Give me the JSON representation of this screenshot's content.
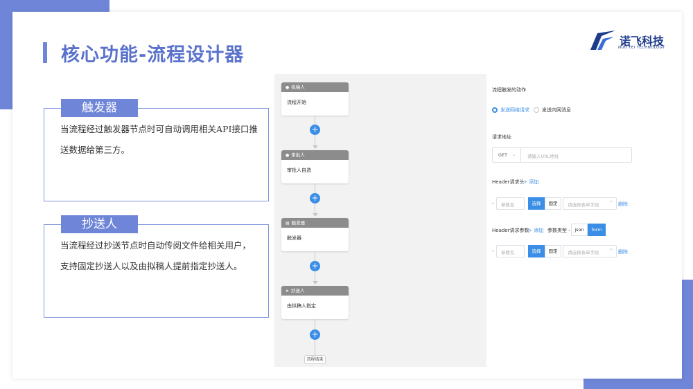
{
  "title": "核心功能-流程设计器",
  "logo": {
    "cn": "诺飞科技",
    "en": "NUO FEI TECHNOLOGY"
  },
  "features": [
    {
      "tag": "触发器",
      "lines": [
        "当流程经过触发器节点时可自动调用相关API接口推",
        "送数据给第三方。"
      ]
    },
    {
      "tag": "抄送人",
      "lines": [
        "当流程经过抄送节点时自动传阅文件给相关用户，",
        "支持固定抄送人以及由拟稿人提前指定抄送人。"
      ]
    }
  ],
  "flow": {
    "nodes": [
      {
        "head": "拟稿人",
        "body": "流程开始",
        "icon": "user-icon"
      },
      {
        "head": "审批人",
        "body": "审批人自选",
        "icon": "user-icon"
      },
      {
        "head": "触发器",
        "body": "触发器",
        "icon": "trigger-icon"
      },
      {
        "head": "抄送人",
        "body": "由拟稿人指定",
        "icon": "send-icon"
      }
    ],
    "plus_label": "+",
    "end_label": "流程结束"
  },
  "config": {
    "action_label": "流程触发的动作",
    "radio_options": [
      {
        "label": "发送网络请求",
        "selected": true
      },
      {
        "label": "发送内网消息",
        "selected": false
      }
    ],
    "url_label": "请求地址",
    "method": "GET",
    "url_placeholder": "请输入URL地址",
    "header_label": "Header请求头",
    "add_label": "+ 添加",
    "header_row": {
      "dash": "-",
      "param_placeholder": "参数名",
      "btn_select": "选择",
      "btn_fixed": "固定",
      "select_placeholder": "请选择表单字段",
      "delete": "删除"
    },
    "param_label": "Header请求参数",
    "param_type_label": "参数类型 -",
    "type_options": [
      {
        "label": "json",
        "selected": false
      },
      {
        "label": "form",
        "selected": true
      }
    ],
    "param_row": {
      "dash": "-",
      "param_placeholder": "参数名",
      "btn_select": "选择",
      "btn_fixed": "固定",
      "select_placeholder": "请选择表单字段",
      "delete": "删除"
    }
  },
  "colors": {
    "accent": "#6f86d8",
    "primary_blue": "#3a8ee6",
    "node_head": "#8c8c8c"
  }
}
